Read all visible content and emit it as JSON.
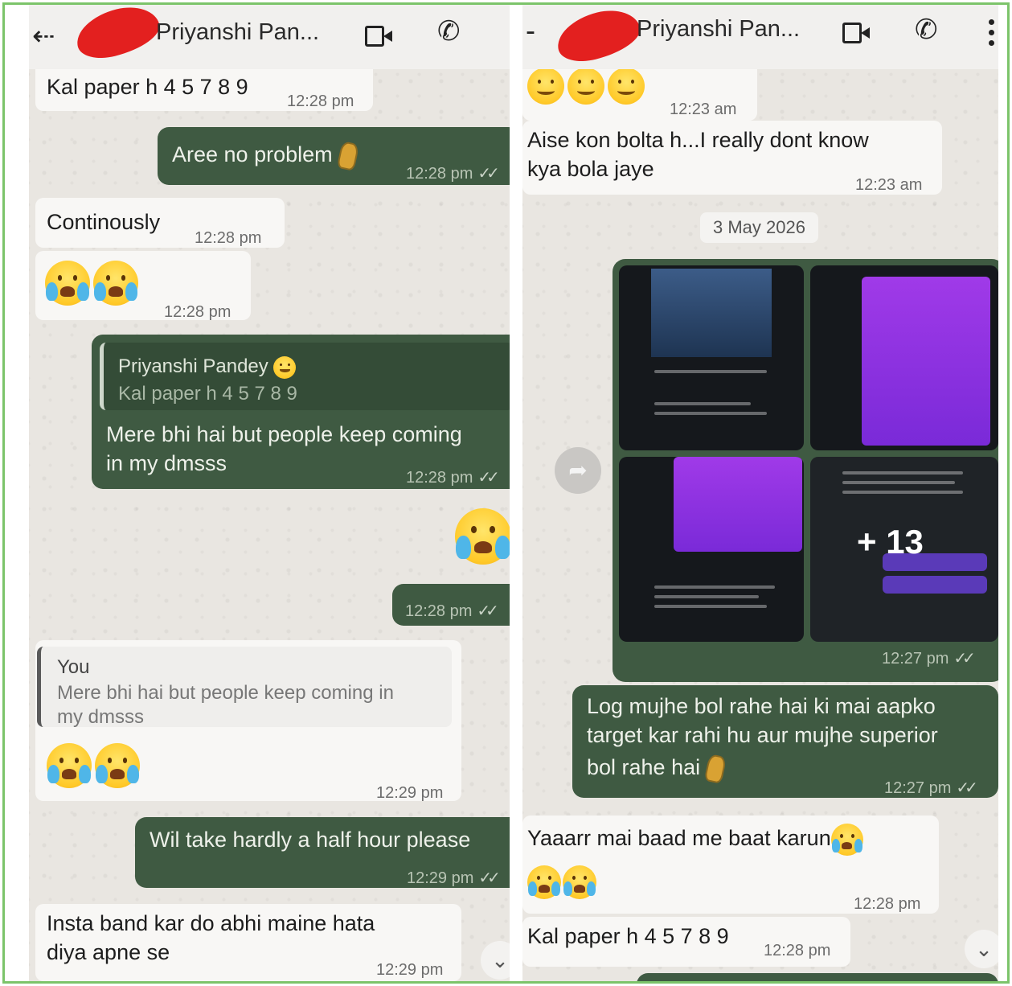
{
  "left_chat": {
    "contact_name": "Priyanshi Pan...",
    "messages": {
      "m1": {
        "text": "Kal paper h 4 5 7 8 9",
        "time": "12:28 pm"
      },
      "m2": {
        "text": "Aree no problem",
        "time": "12:28 pm"
      },
      "m3": {
        "text": "Continously",
        "time": "12:28 pm"
      },
      "m4": {
        "time": "12:28 pm"
      },
      "m5": {
        "quote_author": "Priyanshi Pandey",
        "quote_text": "Kal paper h 4 5 7 8 9",
        "line1": "Mere bhi hai but people keep coming",
        "line2": "in my dmsss",
        "time": "12:28 pm"
      },
      "m6": {
        "time": "12:28 pm"
      },
      "m7": {
        "quote_author": "You",
        "quote_line1": "Mere bhi hai but people keep coming in",
        "quote_line2": "my dmsss",
        "time": "12:29 pm"
      },
      "m8": {
        "text": "Wil take hardly a half hour please",
        "time": "12:29 pm"
      },
      "m9": {
        "line1": "Insta band kar do abhi maine hata",
        "line2": "diya apne se",
        "time": "12:29 pm"
      }
    }
  },
  "right_chat": {
    "contact_name": "Priyanshi Pan...",
    "messages": {
      "r1": {
        "time": "12:23 am"
      },
      "r2": {
        "line1": "Aise kon bolta h...I really dont know",
        "line2": "kya bola jaye",
        "time": "12:23 am"
      },
      "date_divider": "3 May 2026",
      "media": {
        "more_count": "+ 13",
        "time": "12:27 pm"
      },
      "r3": {
        "line1": "Log mujhe bol rahe hai ki mai aapko",
        "line2": "target kar rahi hu aur mujhe superior",
        "line3": "bol rahe hai",
        "time": "12:27 pm"
      },
      "r4": {
        "text": "Yaaarr mai baad me baat karun",
        "time": "12:28 pm"
      },
      "r5": {
        "text": "Kal paper h 4 5 7 8 9",
        "time": "12:28 pm"
      }
    }
  },
  "icons": {
    "back": "arrow-left",
    "video": "video-camera",
    "call": "phone",
    "menu": "vertical-ellipsis",
    "forward": "forward-arrow",
    "scroll_down": "double-chevron-down",
    "read_receipt": "double-check"
  },
  "colors": {
    "outgoing_bubble": "#3f5a42",
    "incoming_bubble": "#f8f7f5",
    "chat_background": "#e9e6e1",
    "frame_border": "#7cc46a",
    "avatar_redaction": "#e3201f"
  }
}
